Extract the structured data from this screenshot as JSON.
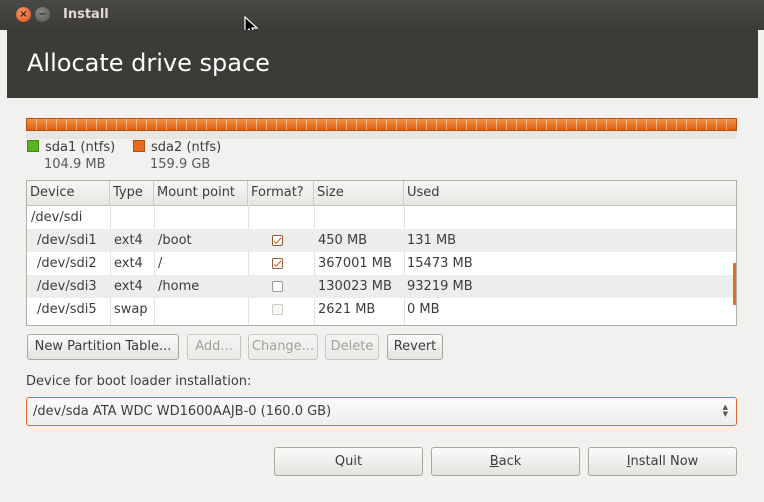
{
  "window": {
    "title": "Install",
    "close_glyph": "×",
    "min_glyph": "−"
  },
  "header": {
    "title": "Allocate drive space"
  },
  "partition_bar": {
    "segments": [
      {
        "label": "sda1 (ntfs)",
        "size": "104.9 MB",
        "color": "#5bb31d"
      },
      {
        "label": "sda2 (ntfs)",
        "size": "159.9 GB",
        "color": "#e96b1a"
      }
    ]
  },
  "table": {
    "columns": [
      "Device",
      "Type",
      "Mount point",
      "Format?",
      "Size",
      "Used"
    ],
    "rows": [
      {
        "device": "/dev/sdi",
        "type": "",
        "mount": "",
        "format": null,
        "size": "",
        "used": ""
      },
      {
        "device": "/dev/sdi1",
        "type": "ext4",
        "mount": "/boot",
        "format": "checked",
        "size": "450 MB",
        "used": "131 MB"
      },
      {
        "device": "/dev/sdi2",
        "type": "ext4",
        "mount": "/",
        "format": "checked",
        "size": "367001 MB",
        "used": "15473 MB"
      },
      {
        "device": "/dev/sdi3",
        "type": "ext4",
        "mount": "/home",
        "format": "unchecked",
        "size": "130023 MB",
        "used": "93219 MB"
      },
      {
        "device": "/dev/sdi5",
        "type": "swap",
        "mount": "",
        "format": "disabled",
        "size": "2621 MB",
        "used": "0 MB"
      }
    ]
  },
  "actions": {
    "new_table": "New Partition Table...",
    "add": "Add...",
    "change": "Change...",
    "delete": "Delete",
    "revert": "Revert"
  },
  "bootloader": {
    "label": "Device for boot loader installation:",
    "selected": "/dev/sda ATA WDC WD1600AAJB-0 (160.0 GB)"
  },
  "footer": {
    "quit": "Quit",
    "back_key": "B",
    "back_rest": "ack",
    "install_key": "I",
    "install_rest": "nstall Now"
  },
  "colors": {
    "accent": "#e96b1a",
    "header_bg": "#3c3b37",
    "window_bg": "#f2f1f0"
  }
}
